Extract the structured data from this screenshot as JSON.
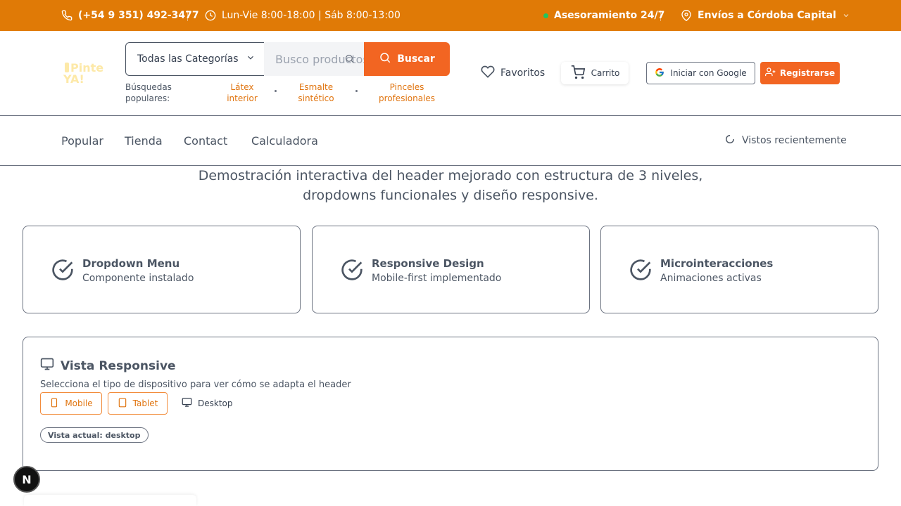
{
  "topbar": {
    "phone": "(+54 9 351) 492-3477",
    "hours": "Lun-Vie 8:00-18:00 | Sáb 8:00-13:00",
    "advice": "Asesoramiento 24/7",
    "shipping": "Envíos a Córdoba Capital",
    "background_color": "#e07a06"
  },
  "header": {
    "logo": {
      "line1": "Pinte",
      "line2": "YA!"
    },
    "category_select": "Todas las Categorías",
    "search_placeholder": "Busco productos",
    "search_button": "Buscar",
    "popular_label": "Búsquedas populares:",
    "popular_searches": [
      "Látex interior",
      "Esmalte sintético",
      "Pinceles profesionales"
    ],
    "favorites": "Favoritos",
    "cart": "Carrito",
    "google_login": "Iniciar con Google",
    "register": "Registrarse",
    "accent_color": "#f26522"
  },
  "nav": {
    "items": [
      "Popular",
      "Tienda",
      "Contact",
      "Calculadora"
    ],
    "recent": "Vistos recientemente"
  },
  "intro": {
    "line1": "Demostración interactiva del header mejorado con estructura de 3 niveles,",
    "line2": "dropdowns funcionales y diseño responsive."
  },
  "features": [
    {
      "title": "Dropdown Menu",
      "subtitle": "Componente instalado"
    },
    {
      "title": "Responsive Design",
      "subtitle": "Mobile-first implementado"
    },
    {
      "title": "Microinteracciones",
      "subtitle": "Animaciones activas"
    }
  ],
  "responsive_panel": {
    "title": "Vista Responsive",
    "description": "Selecciona el tipo de dispositivo para ver cómo se adapta el header",
    "devices": [
      "Mobile",
      "Tablet",
      "Desktop"
    ],
    "current_view": "Vista actual: desktop"
  },
  "dev_badge": "N"
}
